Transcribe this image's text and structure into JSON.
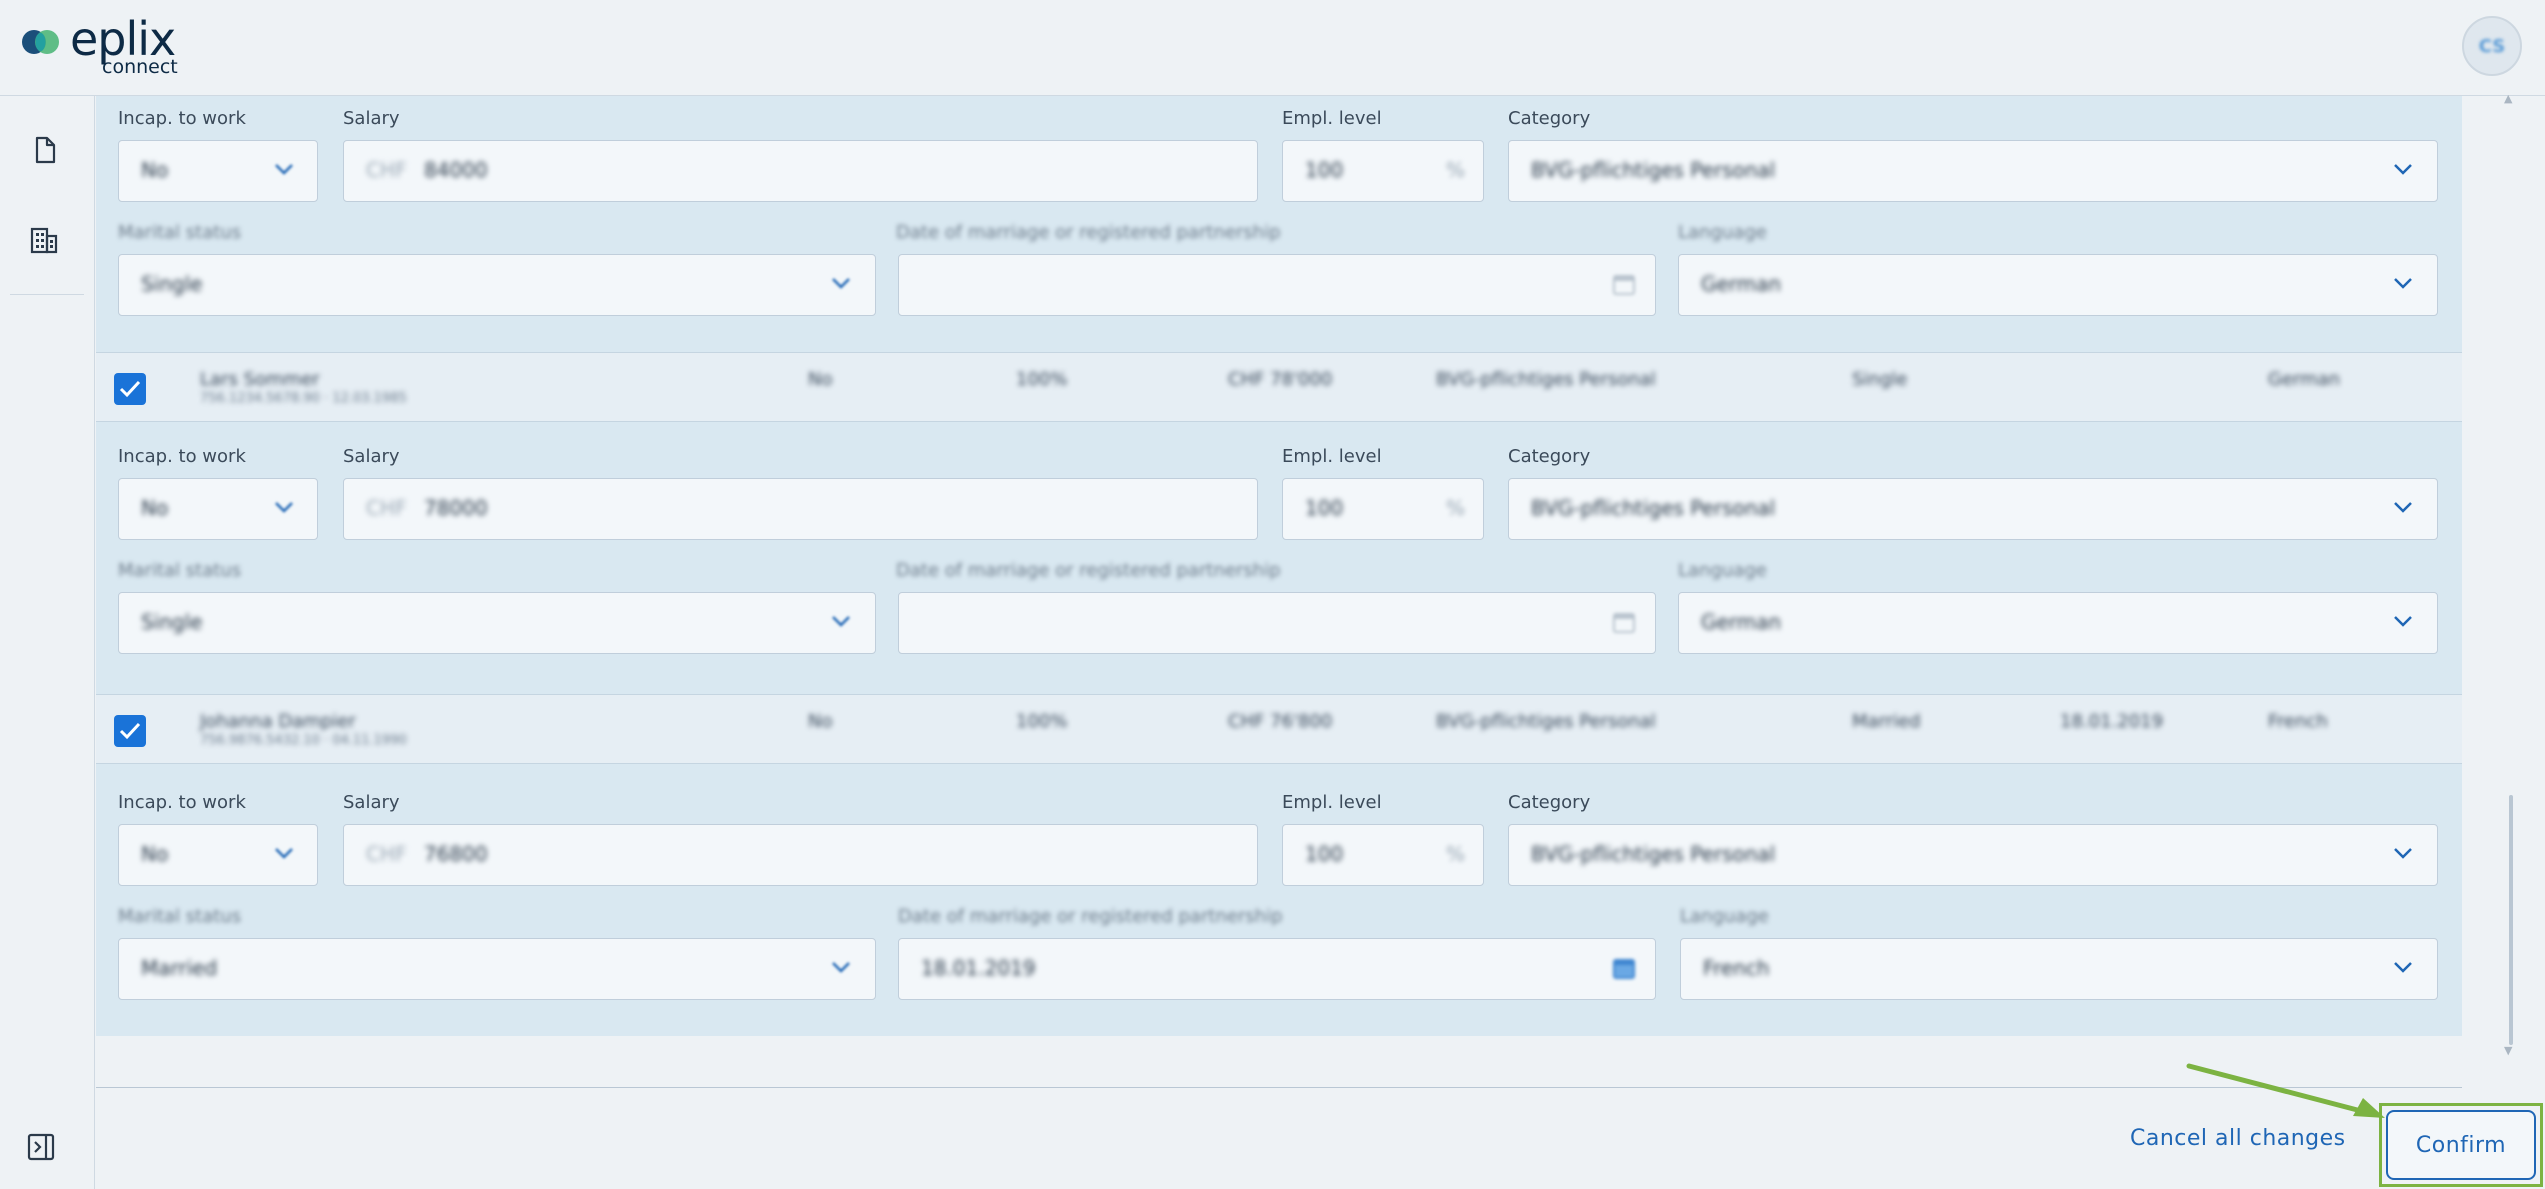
{
  "app": {
    "logo_word": "eplix",
    "logo_sub": "connect",
    "avatar_initials": "CS"
  },
  "sidebar": {
    "icons": [
      "document-icon",
      "building-icon"
    ],
    "collapse_icon": "panel-collapse-icon"
  },
  "labels": {
    "incap": "Incap. to work",
    "salary": "Salary",
    "empl_level": "Empl. level",
    "category": "Category",
    "marital": "Marital status",
    "date_marriage": "Date of marriage or registered partnership",
    "language": "Language"
  },
  "employees": [
    {
      "form": {
        "incap": "No",
        "currency": "CHF",
        "salary": "84000",
        "empl_level": "100",
        "category": "BVG-pflichtiges Personal",
        "marital": "Single",
        "date_marriage": "",
        "language": "German"
      }
    },
    {
      "summary": {
        "name": "Lars Sommer",
        "sub": "756.1234.5678.90 · 12.03.1985",
        "incap": "No",
        "level": "100%",
        "salary": "CHF 78'000",
        "category": "BVG-pflichtiges Personal",
        "marital": "Single",
        "date_marriage": "",
        "language": "German",
        "checked": true
      },
      "form": {
        "incap": "No",
        "currency": "CHF",
        "salary": "78000",
        "empl_level": "100",
        "category": "BVG-pflichtiges Personal",
        "marital": "Single",
        "date_marriage": "",
        "language": "German"
      }
    },
    {
      "summary": {
        "name": "Johanna Dampier",
        "sub": "756.9876.5432.10 · 04.11.1990",
        "incap": "No",
        "level": "100%",
        "salary": "CHF 76'800",
        "category": "BVG-pflichtiges Personal",
        "marital": "Married",
        "date_marriage": "18.01.2019",
        "language": "French",
        "checked": true
      },
      "form": {
        "incap": "No",
        "currency": "CHF",
        "salary": "76800",
        "empl_level": "100",
        "category": "BVG-pflichtiges Personal",
        "marital": "Married",
        "date_marriage": "18.01.2019",
        "language": "French"
      }
    }
  ],
  "footer": {
    "cancel_label": "Cancel all changes",
    "confirm_label": "Confirm"
  },
  "colors": {
    "accent": "#1f66b5",
    "checkbox": "#1a73d8",
    "highlight": "#7cb342"
  }
}
